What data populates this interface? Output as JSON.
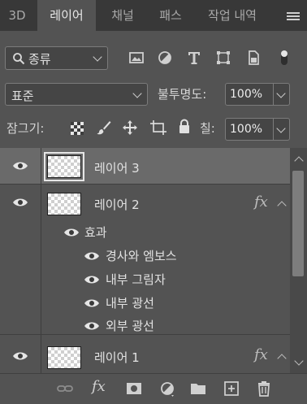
{
  "tabs": [
    {
      "label": "3D",
      "active": false
    },
    {
      "label": "레이어",
      "active": true
    },
    {
      "label": "채널",
      "active": false
    },
    {
      "label": "패스",
      "active": false
    },
    {
      "label": "작업 내역",
      "active": false
    }
  ],
  "filter": {
    "kind_label": "종류",
    "icons": [
      "pixel-filter-icon",
      "adjustment-filter-icon",
      "type-filter-icon",
      "shape-filter-icon",
      "smart-object-filter-icon",
      "filter-toggle-icon"
    ]
  },
  "blend": {
    "mode": "표준",
    "opacity_label": "불투명도:",
    "opacity_value": "100%"
  },
  "lock": {
    "label": "잠그기:",
    "fill_label": "칠:",
    "fill_value": "100%"
  },
  "layers": [
    {
      "name": "레이어 3",
      "selected": true,
      "visible": true,
      "fx": ""
    },
    {
      "name": "레이어 2",
      "selected": false,
      "visible": true,
      "fx": "fx",
      "effects_label": "효과",
      "effects": [
        "경사와 엠보스",
        "내부 그림자",
        "내부 광선",
        "외부 광선"
      ]
    },
    {
      "name": "레이어 1",
      "selected": false,
      "visible": true,
      "fx": "fx"
    }
  ],
  "bottom_fx_label": "fx",
  "colors": {
    "panel_bg": "#535353",
    "tabbar_bg": "#383838",
    "selected_row": "#6a6a6a"
  }
}
